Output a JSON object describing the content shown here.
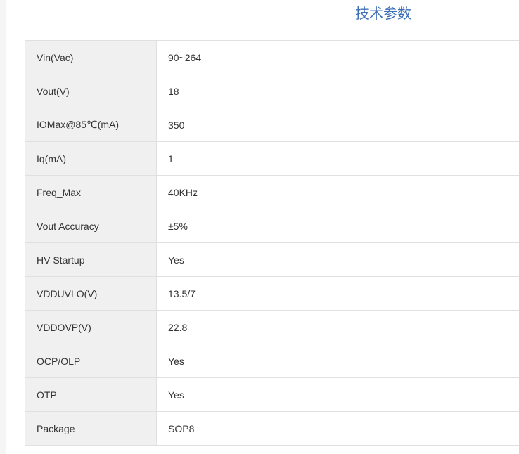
{
  "section": {
    "title": "技术参数"
  },
  "specs": [
    {
      "param": "Vin(Vac)",
      "value": "90~264"
    },
    {
      "param": "Vout(V)",
      "value": "18"
    },
    {
      "param": "IOMax@85℃(mA)",
      "value": "350"
    },
    {
      "param": "Iq(mA)",
      "value": "1"
    },
    {
      "param": "Freq_Max",
      "value": "40KHz"
    },
    {
      "param": "Vout Accuracy",
      "value": "±5%"
    },
    {
      "param": "HV Startup",
      "value": "Yes"
    },
    {
      "param": "VDDUVLO(V)",
      "value": "13.5/7"
    },
    {
      "param": "VDDOVP(V)",
      "value": "22.8"
    },
    {
      "param": "OCP/OLP",
      "value": "Yes"
    },
    {
      "param": "OTP",
      "value": "Yes"
    },
    {
      "param": "Package",
      "value": "SOP8"
    }
  ],
  "colors": {
    "accent": "#3d6fb6",
    "param_bg": "#f0f0f0",
    "border": "#e0e0e0",
    "text": "#333333"
  }
}
